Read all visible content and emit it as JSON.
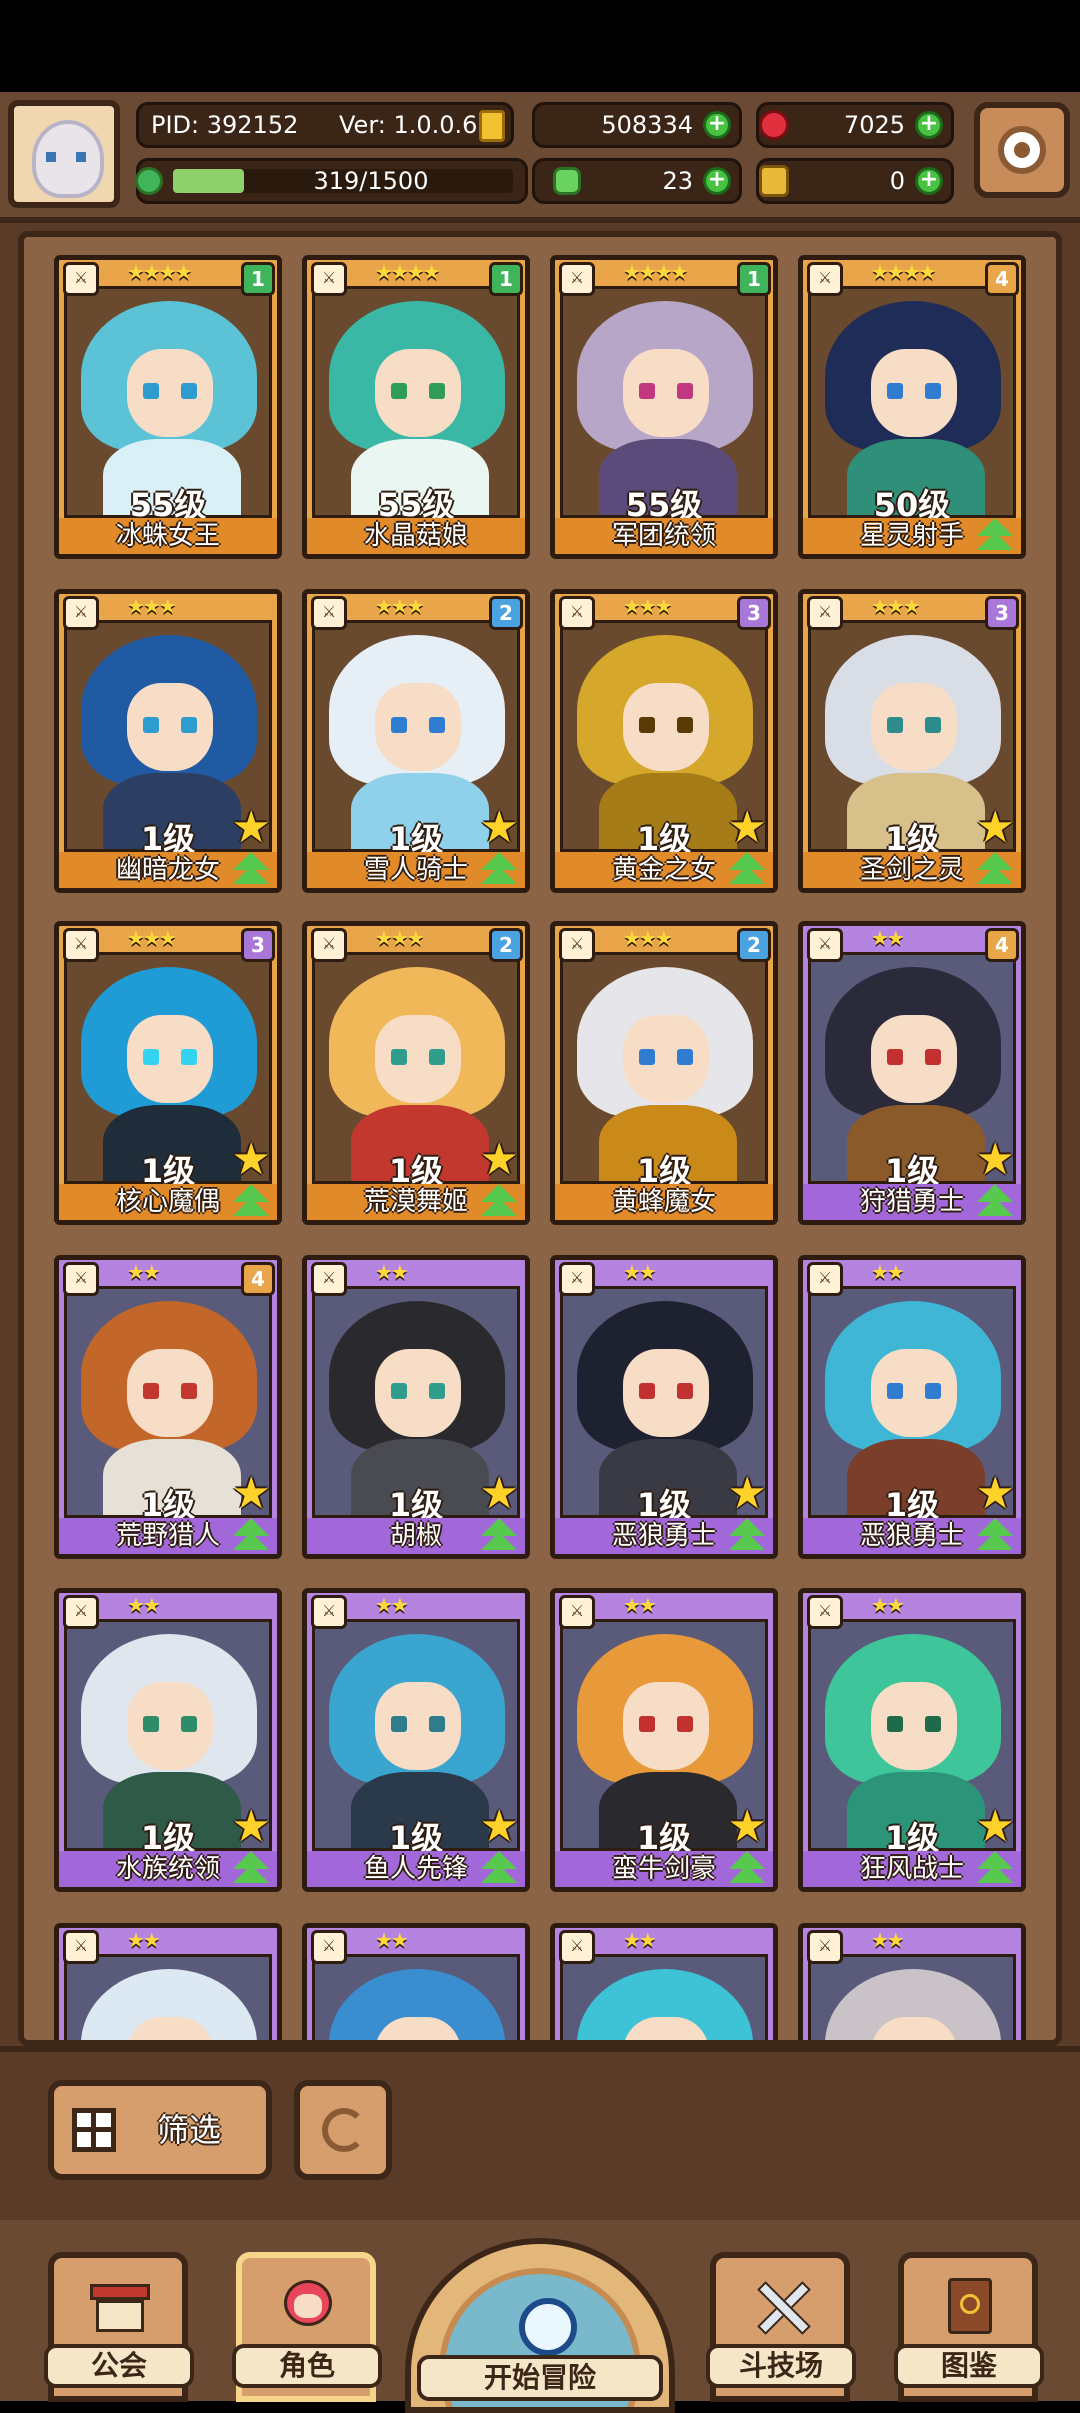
{
  "header": {
    "pid": "PID: 392152",
    "version": "Ver: 1.0.0.6",
    "gold": "508334",
    "gems": "7025",
    "stamina": "319/1500",
    "stamina_fraction": 0.21,
    "clover": "23",
    "keys": "0"
  },
  "cards": [
    {
      "name": "冰蛛女王",
      "level": "55级",
      "stars": "★★★★",
      "rank": "1",
      "frame": "gold",
      "hair": "#5cc3d6",
      "body": "#d8f0f6",
      "eye": "#2f9cd0",
      "upstar": false,
      "uparrow": false
    },
    {
      "name": "水晶菇娘",
      "level": "55级",
      "stars": "★★★★",
      "rank": "1",
      "frame": "gold",
      "hair": "#3bb8a5",
      "body": "#e9f6f1",
      "eye": "#2f9c5a",
      "upstar": false,
      "uparrow": false
    },
    {
      "name": "军团统领",
      "level": "55级",
      "stars": "★★★★",
      "rank": "1",
      "frame": "gold",
      "hair": "#b7a6c8",
      "body": "#5b4b7a",
      "eye": "#c2387f",
      "upstar": false,
      "uparrow": false
    },
    {
      "name": "星灵射手",
      "level": "50级",
      "stars": "★★★★",
      "rank": "4",
      "frame": "gold",
      "hair": "#1e2c57",
      "body": "#2f8f78",
      "eye": "#2f7cd0",
      "upstar": false,
      "uparrow": true
    },
    {
      "name": "幽暗龙女",
      "level": "1级",
      "stars": "★★★",
      "rank": "",
      "frame": "gold",
      "hair": "#1f5aa2",
      "body": "#2c3f63",
      "eye": "#2f9cd0",
      "upstar": true,
      "uparrow": true
    },
    {
      "name": "雪人骑士",
      "level": "1级",
      "stars": "★★★",
      "rank": "2",
      "frame": "gold",
      "hair": "#e6eef6",
      "body": "#8fd0ea",
      "eye": "#2f7cd0",
      "upstar": true,
      "uparrow": true
    },
    {
      "name": "黄金之女",
      "level": "1级",
      "stars": "★★★",
      "rank": "3",
      "frame": "gold",
      "hair": "#d5a72a",
      "body": "#a57c18",
      "eye": "#5a3b08",
      "upstar": true,
      "uparrow": true
    },
    {
      "name": "圣剑之灵",
      "level": "1级",
      "stars": "★★★",
      "rank": "3",
      "frame": "gold",
      "hair": "#d8dde6",
      "body": "#d7c08a",
      "eye": "#2f8c8c",
      "upstar": true,
      "uparrow": true
    },
    {
      "name": "核心魔偶",
      "level": "1级",
      "stars": "★★★",
      "rank": "3",
      "frame": "gold",
      "hair": "#1f9cd6",
      "body": "#1f2c3a",
      "eye": "#32d2f0",
      "upstar": true,
      "uparrow": true
    },
    {
      "name": "荒漠舞姬",
      "level": "1级",
      "stars": "★★★",
      "rank": "2",
      "frame": "gold",
      "hair": "#f1b85a",
      "body": "#c2382f",
      "eye": "#2f9c8c",
      "upstar": true,
      "uparrow": true
    },
    {
      "name": "黄蜂魔女",
      "level": "1级",
      "stars": "★★★",
      "rank": "2",
      "frame": "gold",
      "hair": "#e6e6ea",
      "body": "#c98a1a",
      "eye": "#2f7cd0",
      "upstar": false,
      "uparrow": false
    },
    {
      "name": "狩猎勇士",
      "level": "1级",
      "stars": "★★",
      "rank": "4",
      "frame": "purple",
      "hair": "#2a2a3a",
      "body": "#8a5a2a",
      "eye": "#c23030",
      "upstar": true,
      "uparrow": true
    },
    {
      "name": "荒野猎人",
      "level": "1级",
      "stars": "★★",
      "rank": "4",
      "frame": "purple",
      "hair": "#c2662a",
      "body": "#e6e0d6",
      "eye": "#c2382f",
      "upstar": true,
      "uparrow": true
    },
    {
      "name": "胡椒",
      "level": "1级",
      "stars": "★★",
      "rank": "",
      "frame": "purple",
      "hair": "#2a2a2e",
      "body": "#4a4a52",
      "eye": "#2f9c8c",
      "upstar": true,
      "uparrow": true
    },
    {
      "name": "恶狼勇士",
      "level": "1级",
      "stars": "★★",
      "rank": "",
      "frame": "purple",
      "hair": "#1e2230",
      "body": "#3a3a44",
      "eye": "#c23030",
      "upstar": true,
      "uparrow": true
    },
    {
      "name": "恶狼勇士",
      "level": "1级",
      "stars": "★★",
      "rank": "",
      "frame": "purple",
      "hair": "#3fb6d6",
      "body": "#7a3e2a",
      "eye": "#2f7cd0",
      "upstar": true,
      "uparrow": true
    },
    {
      "name": "水族统领",
      "level": "1级",
      "stars": "★★",
      "rank": "",
      "frame": "purple",
      "hair": "#dfe6ee",
      "body": "#2f5a48",
      "eye": "#2f8c6a",
      "upstar": true,
      "uparrow": true
    },
    {
      "name": "鱼人先锋",
      "level": "1级",
      "stars": "★★",
      "rank": "",
      "frame": "purple",
      "hair": "#3aa6d0",
      "body": "#2a3a4a",
      "eye": "#2f7c8c",
      "upstar": true,
      "uparrow": true
    },
    {
      "name": "蛮牛剑豪",
      "level": "1级",
      "stars": "★★",
      "rank": "",
      "frame": "purple",
      "hair": "#e89a3a",
      "body": "#2a2a2e",
      "eye": "#c23030",
      "upstar": true,
      "uparrow": true
    },
    {
      "name": "狂风战士",
      "level": "1级",
      "stars": "★★",
      "rank": "",
      "frame": "purple",
      "hair": "#3ec59a",
      "body": "#2c9478",
      "eye": "#1f6a4a",
      "upstar": true,
      "uparrow": true
    },
    {
      "name": "",
      "level": "",
      "stars": "★★",
      "rank": "",
      "frame": "purple",
      "hair": "#dce8f2",
      "body": "#b9d6ea",
      "eye": "#2f7cd0",
      "upstar": false,
      "uparrow": false
    },
    {
      "name": "",
      "level": "",
      "stars": "★★",
      "rank": "",
      "frame": "purple",
      "hair": "#3a8ed0",
      "body": "#2a6aa6",
      "eye": "#2f5a9c",
      "upstar": false,
      "uparrow": false
    },
    {
      "name": "",
      "level": "",
      "stars": "★★",
      "rank": "",
      "frame": "purple",
      "hair": "#3ec3d6",
      "body": "#2a8aa6",
      "eye": "#2f9c5a",
      "upstar": false,
      "uparrow": false
    },
    {
      "name": "",
      "level": "",
      "stars": "★★",
      "rank": "",
      "frame": "purple",
      "hair": "#c9c2c6",
      "body": "#8a7a7e",
      "eye": "#2f8c8c",
      "upstar": false,
      "uparrow": false
    }
  ],
  "rank_colors": {
    "1": "#3fb45a",
    "2": "#4aa3e0",
    "3": "#a877d8",
    "4": "#e8a549"
  },
  "toolbar": {
    "filter_label": "筛选"
  },
  "nav": {
    "guild": "公会",
    "characters": "角色",
    "adventure": "开始冒险",
    "arena": "斗技场",
    "codex": "图鉴"
  }
}
